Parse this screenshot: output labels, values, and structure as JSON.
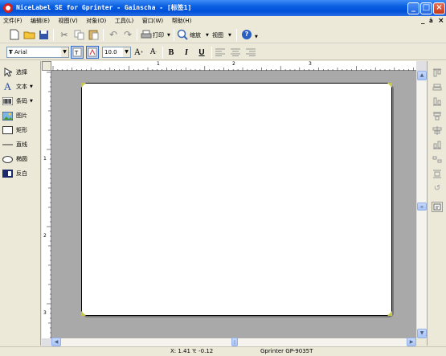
{
  "window": {
    "title": "NiceLabel SE for Gprinter - Gainscha - [标签1]",
    "minimize": "_",
    "maximize": "□",
    "close": "×"
  },
  "menu": {
    "items": [
      "文件(F)",
      "编辑(E)",
      "视图(V)",
      "对象(O)",
      "工具(L)",
      "窗口(W)",
      "帮助(H)"
    ],
    "mdi_min": "_",
    "mdi_restore": "ā",
    "mdi_close": "×"
  },
  "toolbar": {
    "print_label": "打印",
    "zoom_label": "缩放",
    "view_label": "视图",
    "help_glyph": "?"
  },
  "format_toolbar": {
    "font_name": "Arial",
    "font_size": "10.0",
    "bold": "B",
    "italic": "I",
    "underline": "U"
  },
  "tools": [
    {
      "label": "选择",
      "icon": "pointer-icon"
    },
    {
      "label": "文本",
      "icon": "text-icon"
    },
    {
      "label": "条码",
      "icon": "barcode-icon"
    },
    {
      "label": "图片",
      "icon": "picture-icon"
    },
    {
      "label": "矩形",
      "icon": "rectangle-icon"
    },
    {
      "label": "直线",
      "icon": "line-icon"
    },
    {
      "label": "椭圆",
      "icon": "ellipse-icon"
    },
    {
      "label": "反白",
      "icon": "inverse-icon"
    }
  ],
  "ruler": {
    "h_marks": [
      "1",
      "2",
      "3"
    ],
    "v_marks": [
      "1",
      "2",
      "3"
    ]
  },
  "status": {
    "coords": "X: 1.41 Y: -0.12",
    "printer": "Gprinter GP-9035T"
  },
  "colors": {
    "title_blue": "#0a5fe0",
    "canvas_gray": "#a9a9a9",
    "corner_marker": "#c8c840"
  }
}
